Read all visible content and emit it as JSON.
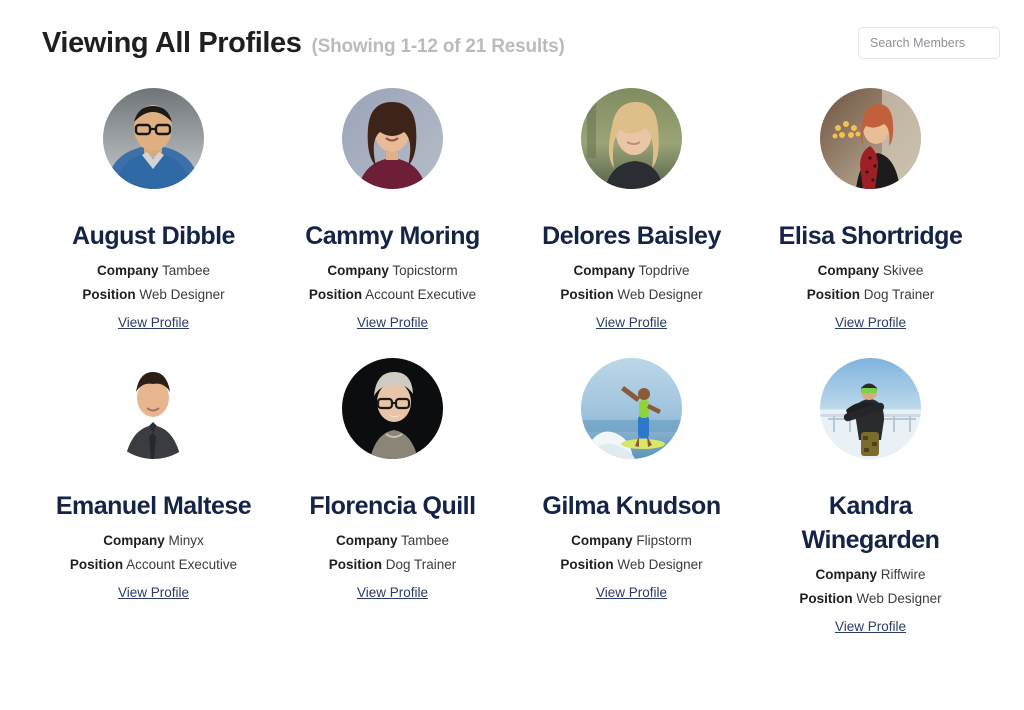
{
  "header": {
    "title": "Viewing All Profiles",
    "subtitle": "(Showing 1-12 of 21 Results)",
    "search_placeholder": "Search Members",
    "search_value": ""
  },
  "labels": {
    "company": "Company",
    "position": "Position",
    "view_profile": "View Profile"
  },
  "colors": {
    "name": "#152347",
    "title": "#1f1f1f",
    "subtitle": "#b9bcbf",
    "link": "#2b3a67",
    "border": "#e2e4e6",
    "background": "#ffffff"
  },
  "profiles": [
    {
      "name": "August Dibble",
      "company": "Tambee",
      "position": "Web Designer",
      "view_profile": "View Profile",
      "avatar": "portrait-man-glasses-denim-jacket"
    },
    {
      "name": "Cammy Moring",
      "company": "Topicstorm",
      "position": "Account Executive",
      "view_profile": "View Profile",
      "avatar": "portrait-woman-brown-hair-maroon-top"
    },
    {
      "name": "Delores Baisley",
      "company": "Topdrive",
      "position": "Web Designer",
      "view_profile": "View Profile",
      "avatar": "portrait-blonde-woman-outdoors"
    },
    {
      "name": "Elisa Shortridge",
      "company": "Skivee",
      "position": "Dog Trainer",
      "view_profile": "View Profile",
      "avatar": "portrait-redhead-woman-red-scarf-indoors"
    },
    {
      "name": "Emanuel Maltese",
      "company": "Minyx",
      "position": "Account Executive",
      "view_profile": "View Profile",
      "avatar": "portrait-man-dark-suit-white-background"
    },
    {
      "name": "Florencia Quill",
      "company": "Tambee",
      "position": "Dog Trainer",
      "view_profile": "View Profile",
      "avatar": "portrait-older-woman-glasses-dark-background"
    },
    {
      "name": "Gilma Knudson",
      "company": "Flipstorm",
      "position": "Web Designer",
      "view_profile": "View Profile",
      "avatar": "photo-surfer-on-wave"
    },
    {
      "name": "Kandra Winegarden",
      "company": "Riffwire",
      "position": "Web Designer",
      "view_profile": "View Profile",
      "avatar": "photo-snowboarder-in-snow"
    }
  ]
}
